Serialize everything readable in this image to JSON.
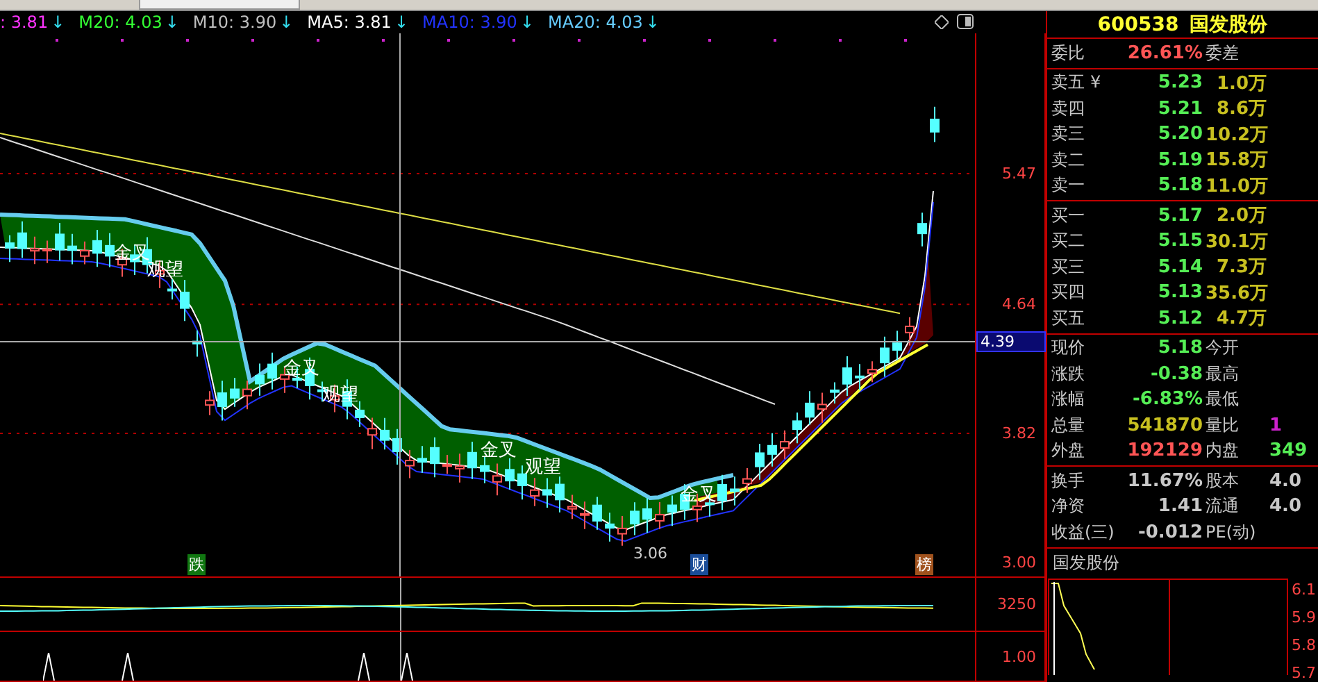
{
  "indicators": [
    {
      "label": ": 3.81",
      "arrow": "↓",
      "color": "#ff33ff"
    },
    {
      "label": "M20: 4.03",
      "arrow": "↓",
      "color": "#33ff33"
    },
    {
      "label": "M10: 3.90",
      "arrow": "↓",
      "color": "#c0c0c0"
    },
    {
      "label": "MA5: 3.81",
      "arrow": "↓",
      "color": "#ffffff"
    },
    {
      "label": "MA10: 3.90",
      "arrow": "↓",
      "color": "#2233ff"
    },
    {
      "label": "MA20: 4.03",
      "arrow": "↓",
      "color": "#66ccff"
    }
  ],
  "chart_signals": [
    "金叉",
    "观望",
    "金叉",
    "观望",
    "金叉",
    "观望",
    "金叉"
  ],
  "low_marker": {
    "text": "3.06"
  },
  "event_tags": [
    {
      "text": "跌",
      "color": "#117711"
    },
    {
      "text": "财",
      "color": "#1a4d99"
    },
    {
      "text": "榜",
      "color": "#a0521d"
    }
  ],
  "price_axis": {
    "ticks": [
      "5.47",
      "4.64",
      "3.82",
      "3.00"
    ],
    "cursor": "4.39"
  },
  "volume_axis": {
    "tick": "3250"
  },
  "lower_axis": {
    "tick": "1.00"
  },
  "quote": {
    "code": "600538",
    "name": "国发股份"
  },
  "weibi": {
    "label": "委比",
    "value": "26.61%",
    "label2": "委差"
  },
  "sell": [
    {
      "label": "卖五",
      "sign": "¥",
      "price": "5.23",
      "volume": "1.0万"
    },
    {
      "label": "卖四",
      "price": "5.21",
      "volume": "8.6万"
    },
    {
      "label": "卖三",
      "price": "5.20",
      "volume": "10.2万"
    },
    {
      "label": "卖二",
      "price": "5.19",
      "volume": "15.8万"
    },
    {
      "label": "卖一",
      "price": "5.18",
      "volume": "11.0万"
    }
  ],
  "buy": [
    {
      "label": "买一",
      "price": "5.17",
      "volume": "2.0万"
    },
    {
      "label": "买二",
      "price": "5.15",
      "volume": "30.1万"
    },
    {
      "label": "买三",
      "price": "5.14",
      "volume": "7.3万"
    },
    {
      "label": "买四",
      "price": "5.13",
      "volume": "35.6万"
    },
    {
      "label": "买五",
      "price": "5.12",
      "volume": "4.7万"
    }
  ],
  "stats": [
    {
      "label": "现价",
      "value": "5.18",
      "color": "#55ee55",
      "label2": "今开"
    },
    {
      "label": "涨跌",
      "value": "-0.38",
      "color": "#55ee55",
      "label2": "最高"
    },
    {
      "label": "涨幅",
      "value": "-6.83%",
      "color": "#55ee55",
      "label2": "最低"
    },
    {
      "label": "总量",
      "value": "541870",
      "color": "#c8c020",
      "label2": "量比",
      "value2": {
        "text": "1",
        "color": "#cc22cc"
      }
    },
    {
      "label": "外盘",
      "value": "192129",
      "color": "#ff5555",
      "label2": "内盘",
      "value2": {
        "text": "349",
        "color": "#55ee55"
      }
    }
  ],
  "fundamentals": [
    {
      "label": "换手",
      "value": "11.67%",
      "label2": "股本",
      "value2": "4.0"
    },
    {
      "label": "净资",
      "value": "1.41",
      "label2": "流通",
      "value2": "4.0"
    },
    {
      "label": "收益(三)",
      "value": "-0.012",
      "label2": "PE(动)"
    }
  ],
  "mini_chart": {
    "title": "国发股份",
    "ticks": [
      "6.1",
      "5.9",
      "5.8",
      "5.7"
    ]
  }
}
